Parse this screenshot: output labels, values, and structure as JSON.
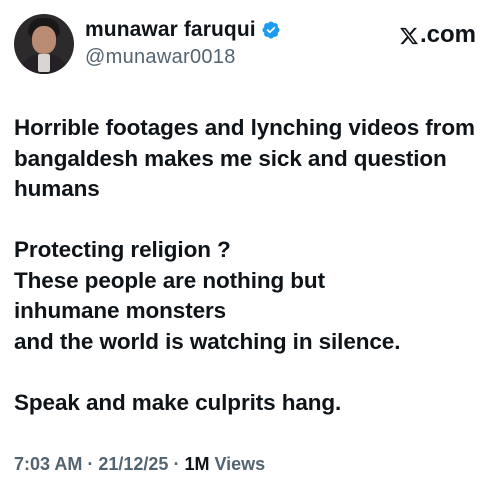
{
  "author": {
    "display_name": "munawar faruqui",
    "handle": "@munawar0018",
    "verified": true,
    "verified_color": "#1d9bf0"
  },
  "brand": {
    "label": ".com",
    "icon": "x-logo-icon"
  },
  "tweet": {
    "text": "Horrible footages and lynching videos from\nbangaldesh makes me sick and question\nhumans\n\nProtecting religion ?\nThese people are nothing but\ninhumane monsters\nand the world is watching in silence.\n\nSpeak and make culprits hang."
  },
  "meta": {
    "time": "7:03 AM",
    "separator": " · ",
    "date": "21/12/25",
    "views_count": "1M",
    "views_label": " Views"
  }
}
